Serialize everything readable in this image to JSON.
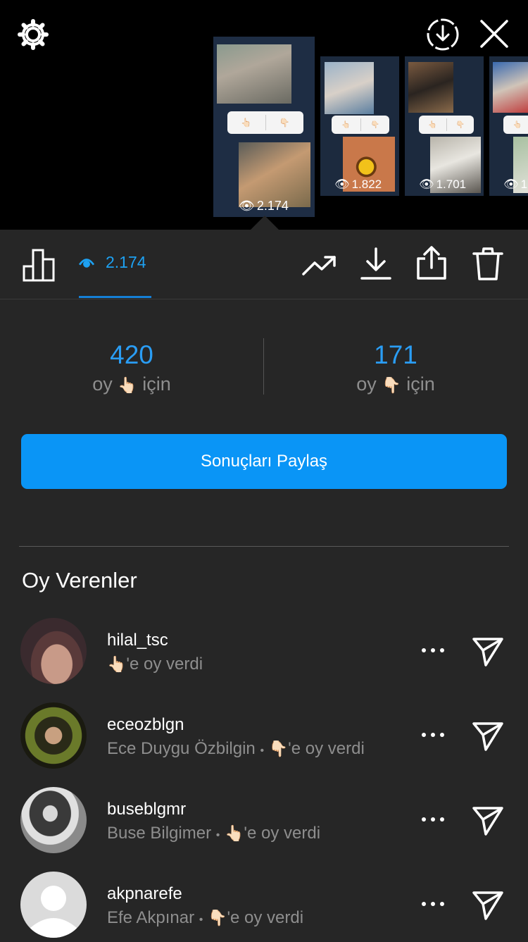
{
  "story_tray": {
    "thumbnails": [
      {
        "views": "2.174",
        "active": true
      },
      {
        "views": "1.822",
        "active": false
      },
      {
        "views": "1.701",
        "active": false
      },
      {
        "views": "1",
        "active": false
      }
    ],
    "poll_options": [
      "👆🏻",
      "👇🏻"
    ]
  },
  "toolbar": {
    "views_count": "2.174"
  },
  "poll_results": {
    "option_a": {
      "count": "420",
      "prefix": "oy",
      "emoji": "👆🏻",
      "suffix": "için"
    },
    "option_b": {
      "count": "171",
      "prefix": "oy",
      "emoji": "👇🏻",
      "suffix": "için"
    }
  },
  "share_button_label": "Sonuçları Paylaş",
  "voters_title": "Oy Verenler",
  "voters": [
    {
      "username": "hilal_tsc",
      "full_name": "",
      "emoji": "👆🏻",
      "vote_text": "'e oy verdi"
    },
    {
      "username": "eceozblgn",
      "full_name": "Ece Duygu Özbilgin",
      "emoji": "👇🏻",
      "vote_text": "'e oy verdi"
    },
    {
      "username": "buseblgmr",
      "full_name": "Buse Bilgimer",
      "emoji": "👆🏻",
      "vote_text": "'e oy verdi"
    },
    {
      "username": "akpnarefe",
      "full_name": "Efe Akpınar",
      "emoji": "👇🏻",
      "vote_text": "'e oy verdi"
    }
  ],
  "colors": {
    "accent": "#0a95f6",
    "count_blue": "#2a9df4",
    "background": "#262626",
    "tray_background": "#000000"
  }
}
